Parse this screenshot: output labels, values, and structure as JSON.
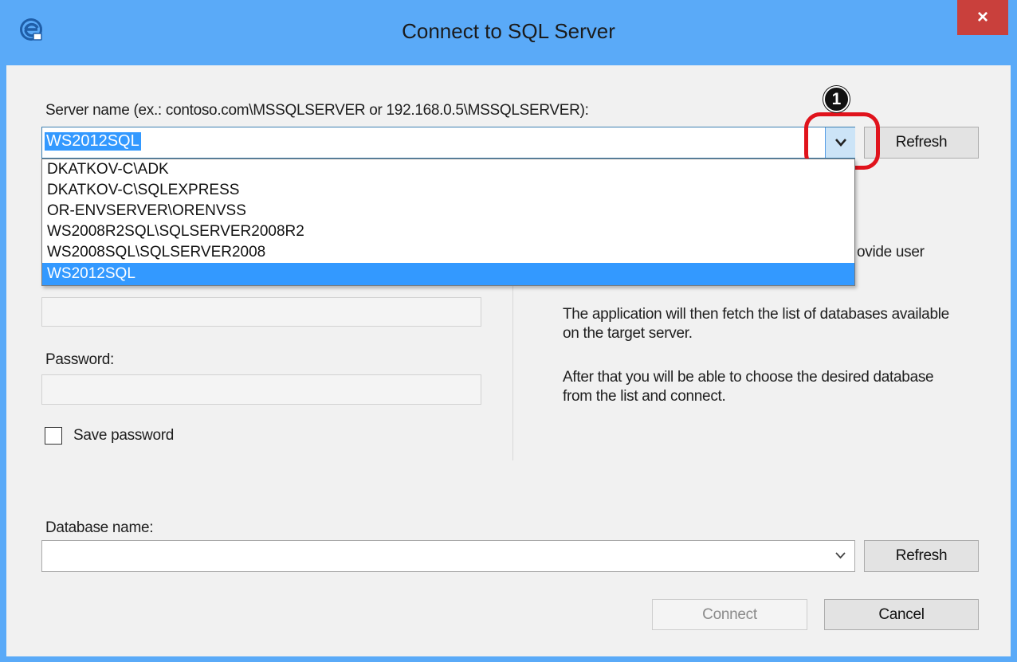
{
  "window": {
    "title": "Connect to SQL Server",
    "close_glyph": "×",
    "icon": "app-e-icon"
  },
  "server": {
    "label": "Server name (ex.: contoso.com\\MSSQLSERVER or 192.168.0.5\\MSSQLSERVER):",
    "value": "WS2012SQL",
    "dropdown_glyph": "🞃",
    "refresh_label": "Refresh",
    "options": [
      "DKATKOV-C\\ADK",
      "DKATKOV-C\\SQLEXPRESS",
      "OR-ENVSERVER\\ORENVSS",
      "WS2008R2SQL\\SQLSERVER2008R2",
      "WS2008SQL\\SQLSERVER2008",
      "WS2012SQL"
    ],
    "selected_option": "WS2012SQL"
  },
  "callout": {
    "number": "1",
    "color": "#e0131c"
  },
  "auth": {
    "password_label": "Password:",
    "save_password_label": "Save password",
    "save_password_checked": false
  },
  "info": {
    "line_partial": "ovide user",
    "paragraph_2": "The application will then fetch the list of databases available on the target server.",
    "paragraph_3": "After that you will be able to choose the desired database from the list and connect."
  },
  "database": {
    "label": "Database name:",
    "value": "",
    "refresh_label": "Refresh"
  },
  "footer": {
    "connect_label": "Connect",
    "cancel_label": "Cancel"
  }
}
